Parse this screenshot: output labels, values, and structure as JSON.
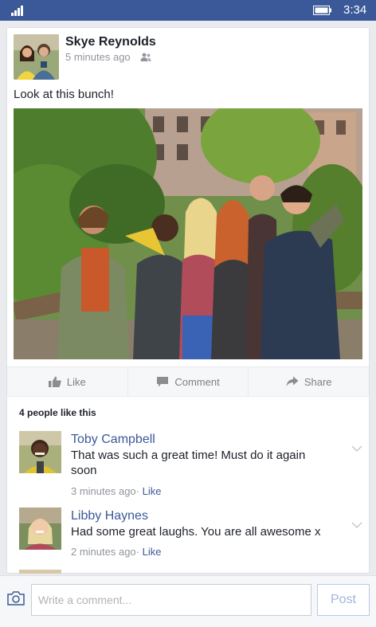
{
  "status_bar": {
    "time": "3:34",
    "signal_icon": "signal-bars-icon",
    "battery_icon": "battery-icon"
  },
  "post": {
    "author": "Skye Reynolds",
    "timestamp": "5 minutes ago",
    "audience_icon": "friends-icon",
    "text": "Look at this bunch!",
    "photo": "group-of-friends-photo"
  },
  "actions": {
    "like_label": "Like",
    "comment_label": "Comment",
    "share_label": "Share"
  },
  "likes_summary": "4 people like this",
  "comments": [
    {
      "name": "Toby Campbell",
      "text": "That was such a great time! Must do it again soon",
      "timestamp": "3 minutes ago",
      "like_label": "Like"
    },
    {
      "name": "Libby Haynes",
      "text": "Had some great laughs. You are all awesome x",
      "timestamp": "2 minutes ago",
      "like_label": "Like"
    }
  ],
  "composer": {
    "placeholder": "Write a comment...",
    "post_label": "Post",
    "camera_icon": "camera-icon"
  },
  "colors": {
    "brand": "#3b5998",
    "link": "#3b5998",
    "background": "#e9ebee"
  }
}
